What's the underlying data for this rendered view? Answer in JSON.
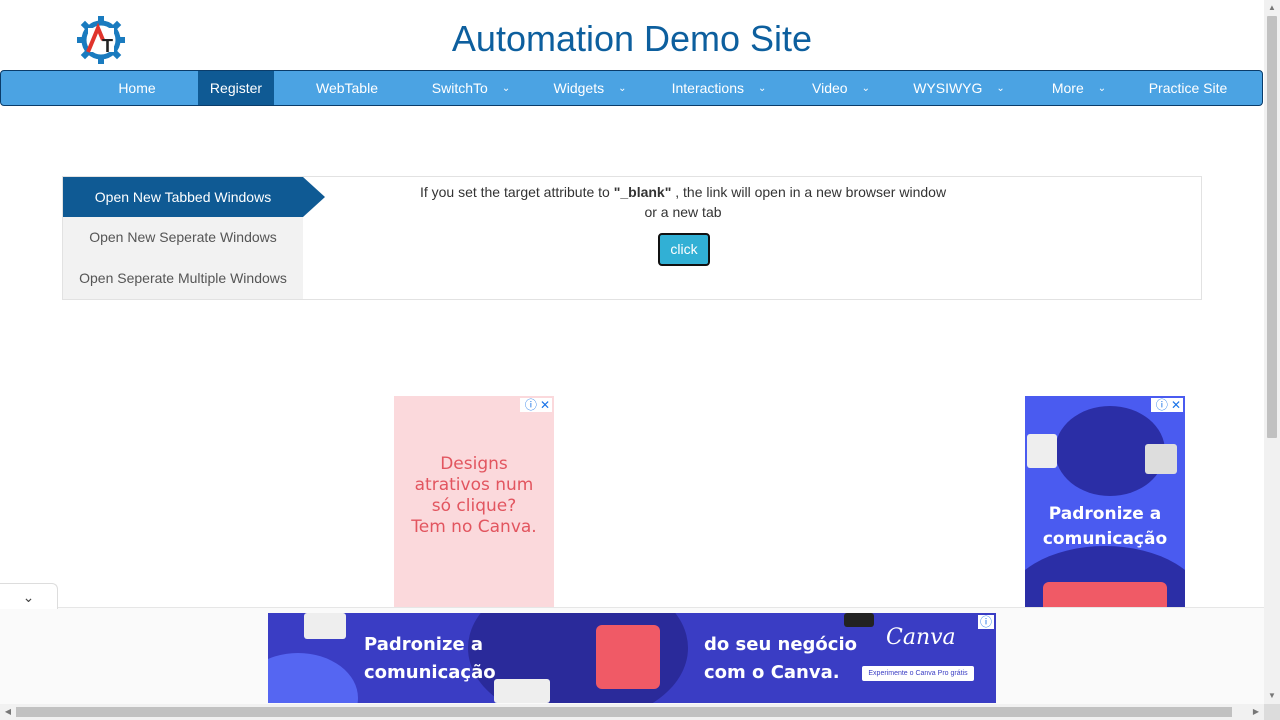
{
  "header": {
    "title": "Automation Demo Site",
    "logo_icon": "gear-logo-icon"
  },
  "nav": {
    "items": [
      {
        "label": "Home",
        "dropdown": false
      },
      {
        "label": "Register",
        "dropdown": false,
        "active": true
      },
      {
        "label": "WebTable",
        "dropdown": false
      },
      {
        "label": "SwitchTo",
        "dropdown": true
      },
      {
        "label": "Widgets",
        "dropdown": true
      },
      {
        "label": "Interactions",
        "dropdown": true
      },
      {
        "label": "Video",
        "dropdown": true
      },
      {
        "label": "WYSIWYG",
        "dropdown": true
      },
      {
        "label": "More",
        "dropdown": true
      },
      {
        "label": "Practice Site",
        "dropdown": false
      }
    ],
    "chevron": "⌄"
  },
  "windows": {
    "tabs": [
      {
        "label": "Open New Tabbed Windows",
        "active": true
      },
      {
        "label": "Open New Seperate Windows"
      },
      {
        "label": "Open Seperate Multiple Windows"
      }
    ],
    "text_before": "If you set the target attribute to ",
    "text_bold": "\"_blank\"",
    "text_after": " , the link will open in a new browser window",
    "text_line2": "or a new tab",
    "button_label": "click"
  },
  "ads": {
    "pink": {
      "line1": "Designs",
      "line2": "atrativos num",
      "line3": "só clique?",
      "line4": "Tem no Canva."
    },
    "blue": {
      "line1": "Padronize a",
      "line2": "comunicação"
    },
    "bottom": {
      "left_line1": "Padronize a",
      "left_line2": "comunicação",
      "right_line1": "do seu negócio",
      "right_line2": "com o Canva.",
      "brand": "Canva",
      "cta": "Experimente o Canva Pro grátis"
    },
    "info_glyph": "ⓘ",
    "close_glyph": "✕"
  },
  "colors": {
    "nav_bg": "#4ba3e3",
    "active": "#0f5a94",
    "title": "#0d5f9e",
    "button": "#31b0d5"
  }
}
